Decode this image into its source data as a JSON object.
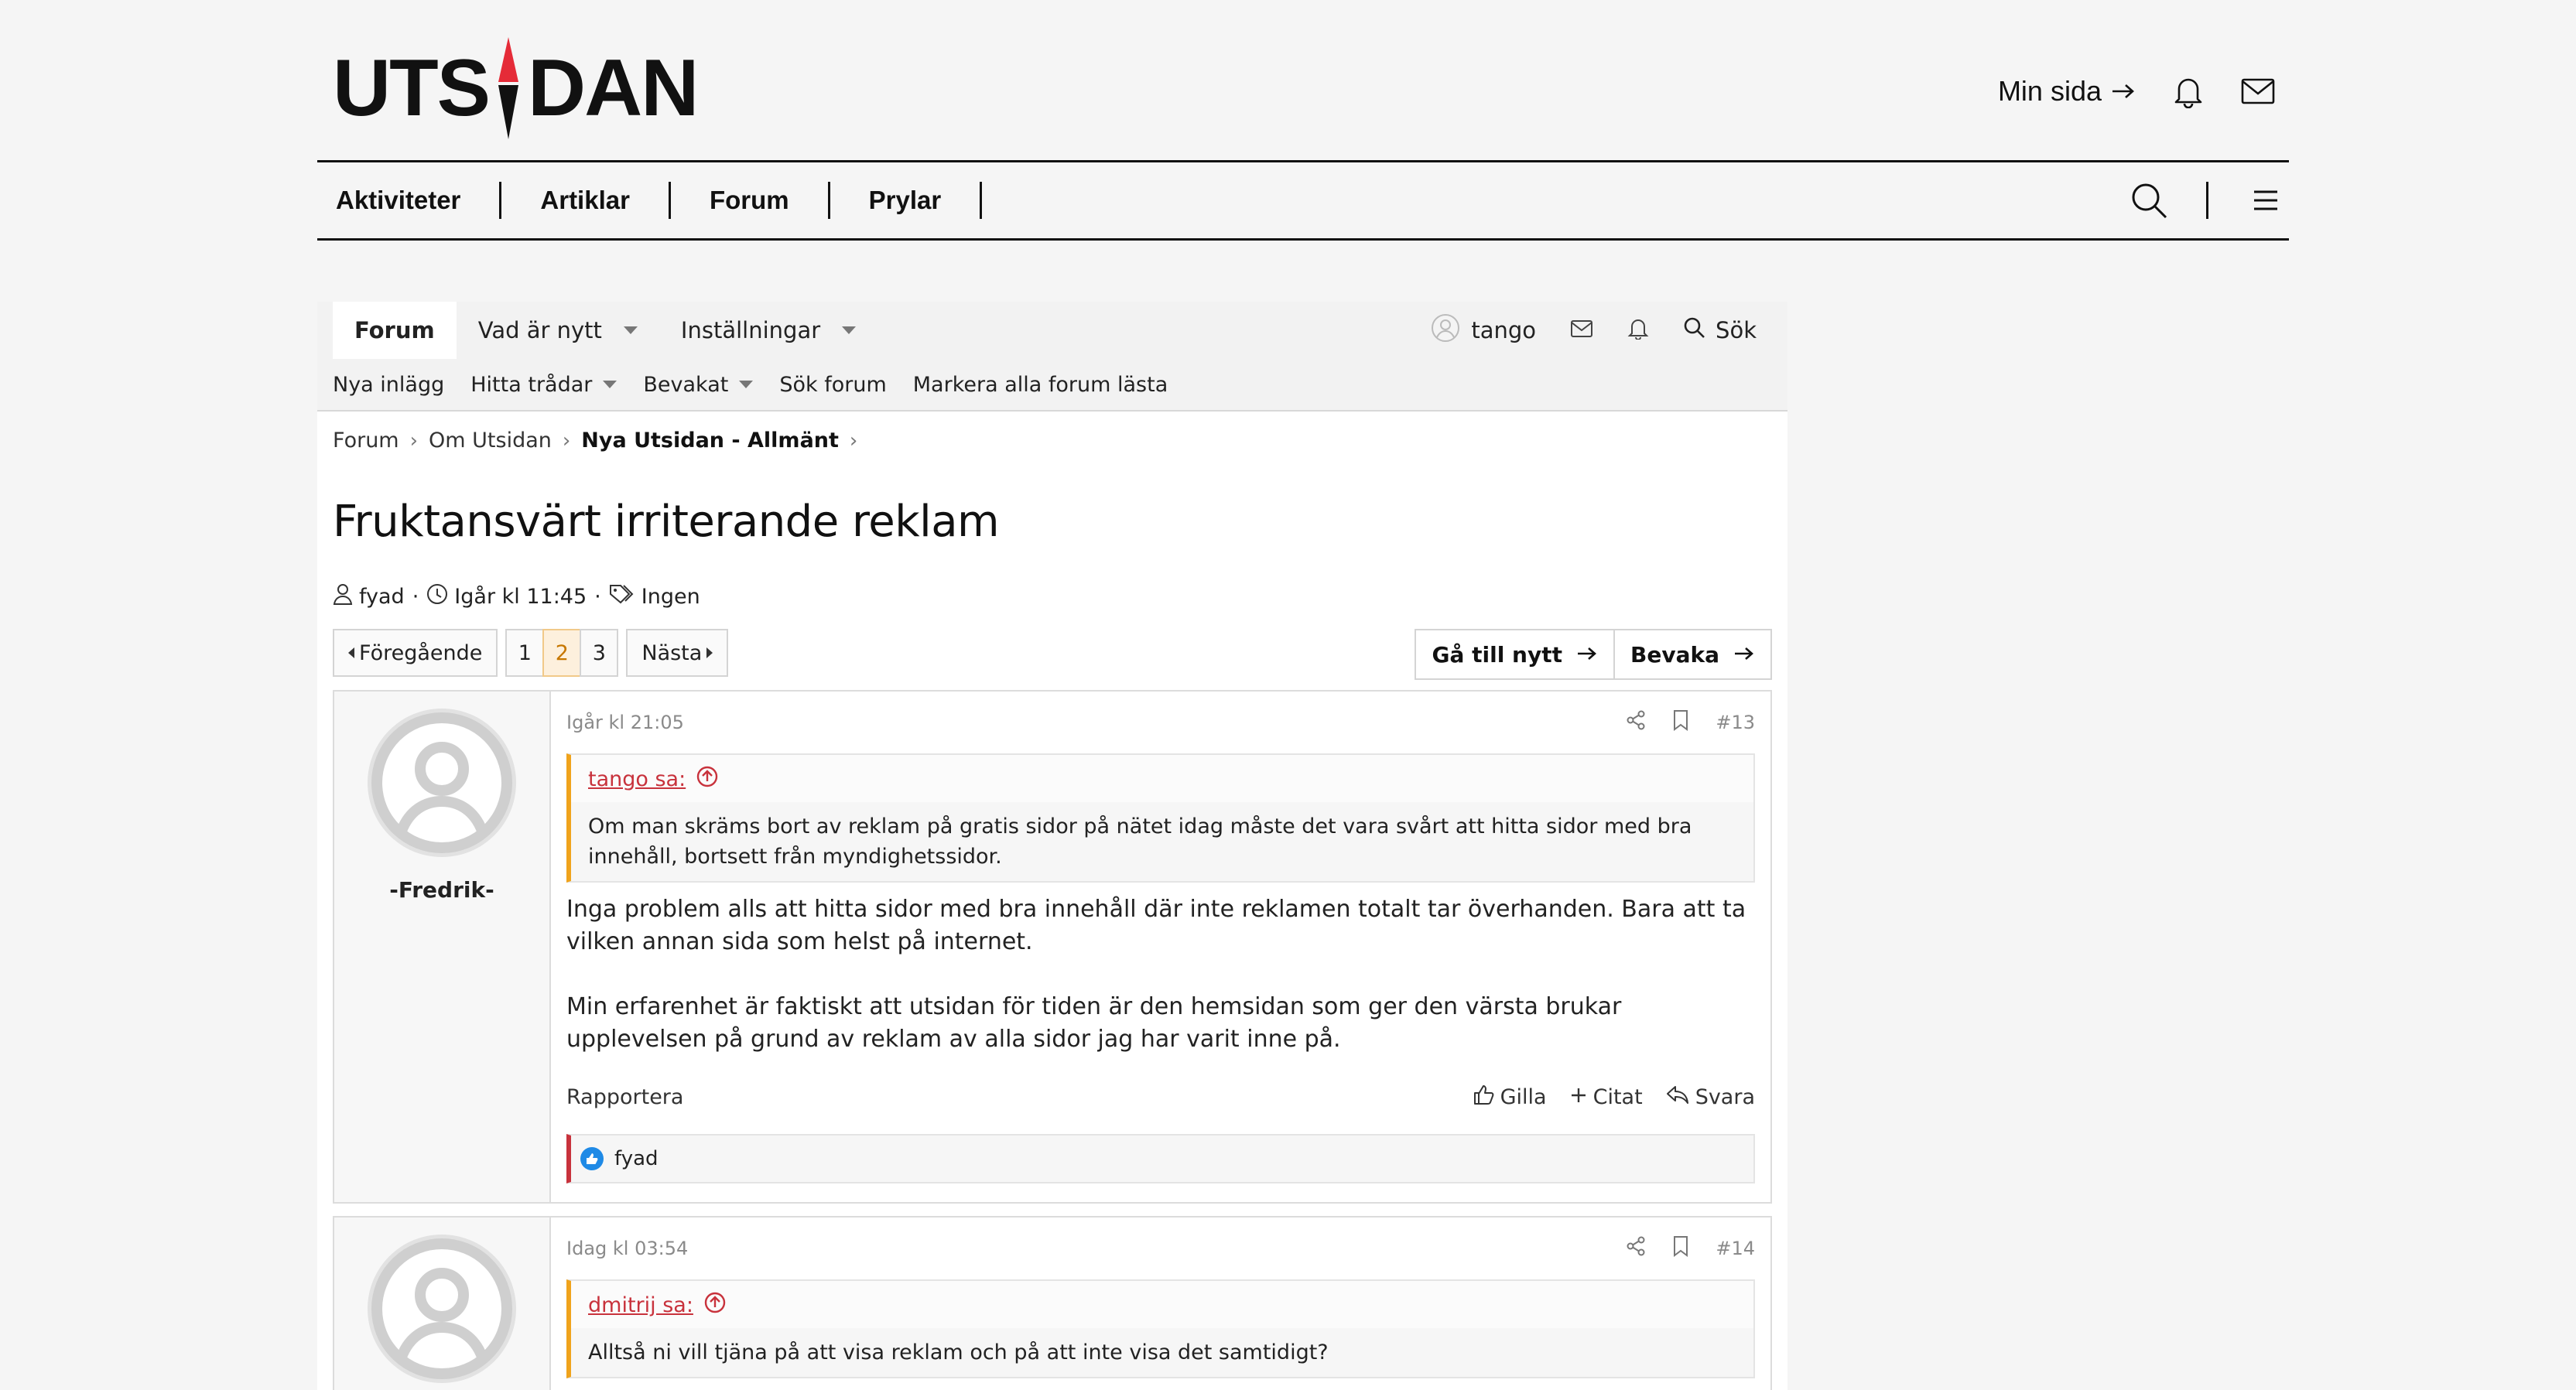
{
  "site": {
    "logo_text_left": "UTS",
    "logo_text_right": "DAN",
    "min_sida": "Min sida",
    "nav": [
      "Aktiviteter",
      "Artiklar",
      "Forum",
      "Prylar"
    ],
    "accent_color": "#e52b38"
  },
  "forum_nav": {
    "tabs": [
      {
        "label": "Forum",
        "active": true
      },
      {
        "label": "Vad är nytt",
        "dropdown": true
      },
      {
        "label": "Inställningar",
        "dropdown": true
      }
    ],
    "username": "tango",
    "search_label": "Sök"
  },
  "sub_nav": [
    {
      "label": "Nya inlägg"
    },
    {
      "label": "Hitta trådar",
      "dropdown": true
    },
    {
      "label": "Bevakat",
      "dropdown": true
    },
    {
      "label": "Sök forum"
    },
    {
      "label": "Markera alla forum lästa"
    }
  ],
  "breadcrumb": [
    "Forum",
    "Om Utsidan",
    "Nya Utsidan - Allmänt"
  ],
  "thread": {
    "title": "Fruktansvärt irriterande reklam",
    "author": "fyad",
    "date": "Igår kl 11:45",
    "tags": "Ingen"
  },
  "pagination": {
    "prev": "Föregående",
    "pages": [
      "1",
      "2",
      "3"
    ],
    "current_page": "2",
    "next": "Nästa",
    "goto_new": "Gå till nytt",
    "watch": "Bevaka"
  },
  "posts": [
    {
      "user": "-Fredrik-",
      "time": "Igår kl 21:05",
      "number": "#13",
      "quote_author": "tango sa:",
      "quote_text": "Om man skräms bort av reklam på gratis sidor på nätet idag måste det vara svårt att hitta sidor med bra innehåll, bortsett från myndighetssidor.",
      "paragraphs": [
        "Inga problem alls att hitta sidor med bra innehåll där inte reklamen totalt tar överhanden. Bara att ta vilken annan sida som helst på internet.",
        "Min erfarenhet är faktiskt att utsidan för tiden är den hemsidan som ger den värsta brukar upplevelsen på grund av reklam av alla sidor jag har varit inne på."
      ],
      "report": "Rapportera",
      "like": "Gilla",
      "quote_action": "Citat",
      "reply": "Svara",
      "reaction_user": "fyad"
    },
    {
      "user": "",
      "time": "Idag kl 03:54",
      "number": "#14",
      "quote_author": "dmitrij sa:",
      "quote_text": "Alltså ni vill tjäna på att visa reklam och på att inte visa det samtidigt?"
    }
  ]
}
